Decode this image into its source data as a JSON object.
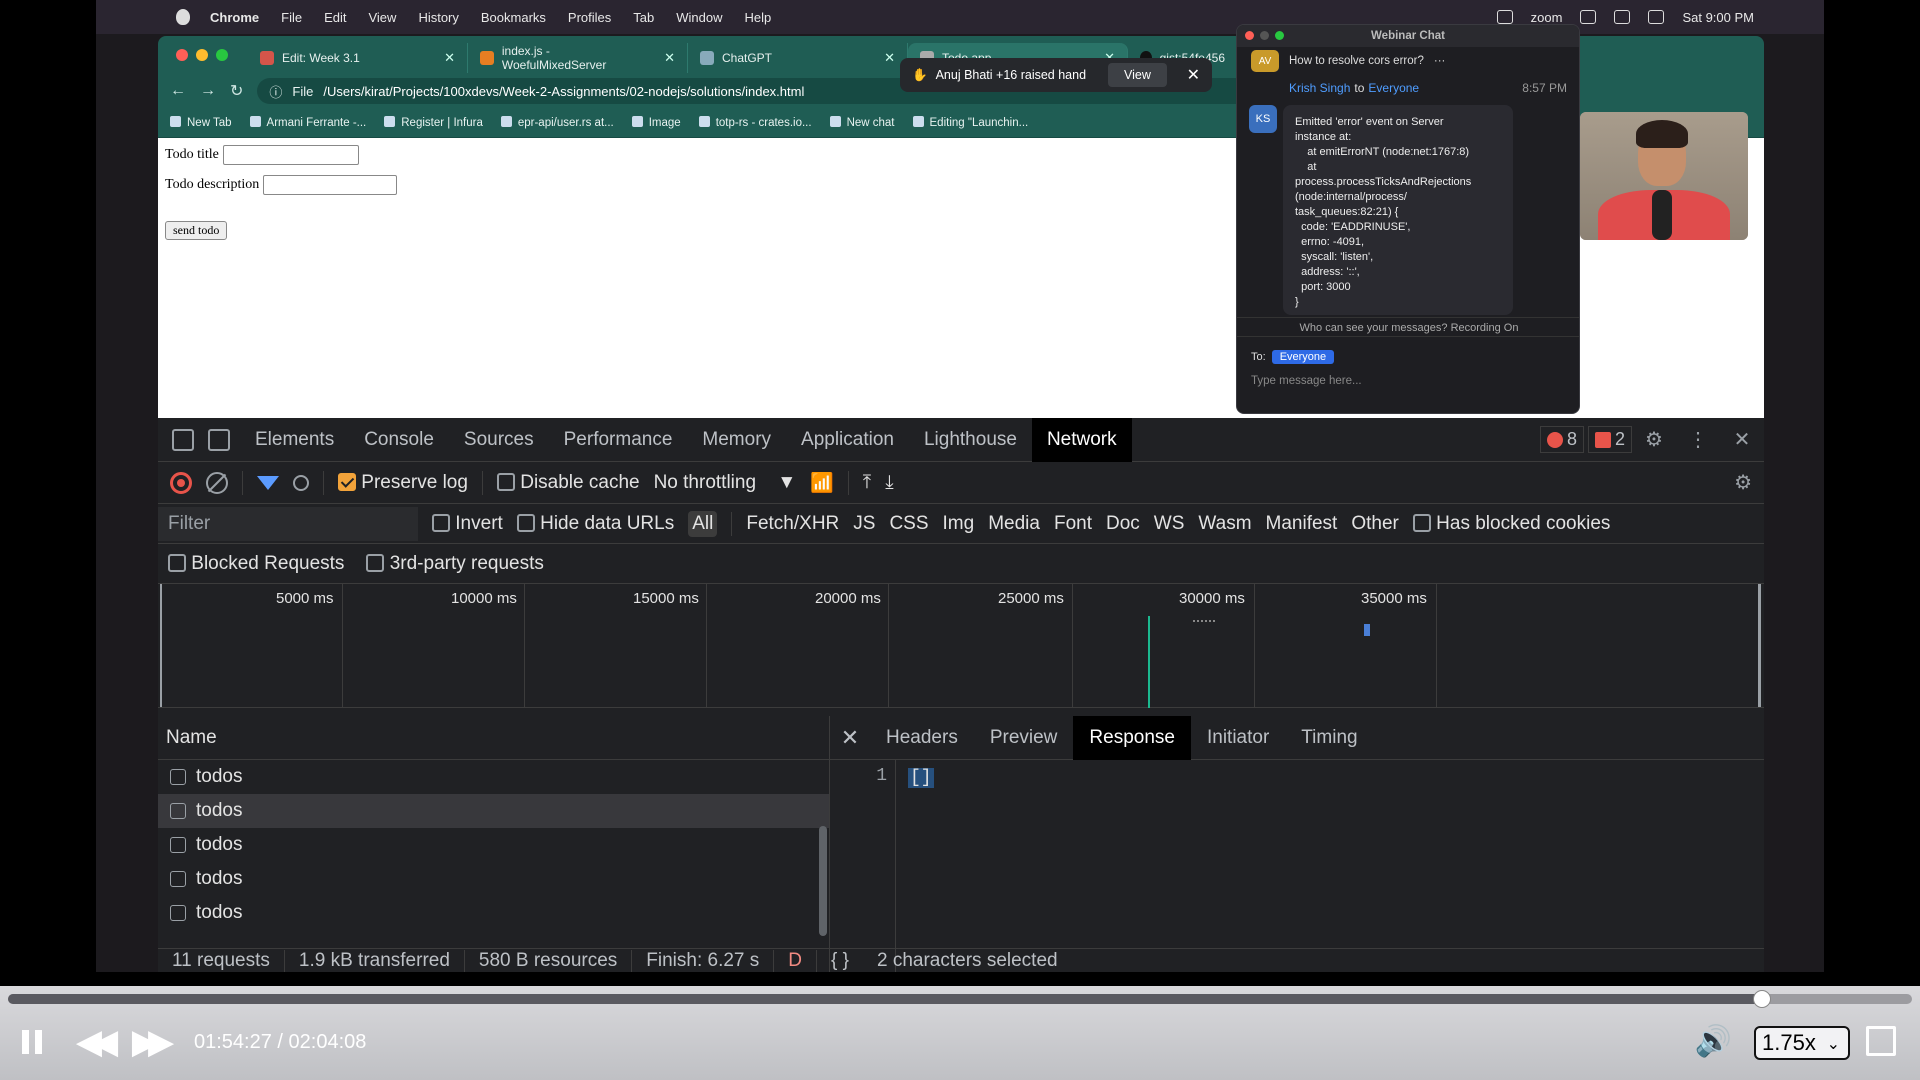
{
  "mac_menu": {
    "app": "Chrome",
    "items": [
      "File",
      "Edit",
      "View",
      "History",
      "Bookmarks",
      "Profiles",
      "Tab",
      "Window",
      "Help"
    ],
    "zoom": "zoom",
    "clock": "Sat 9:00 PM"
  },
  "browser": {
    "tabs": [
      {
        "label": "Edit: Week 3.1"
      },
      {
        "label": "index.js - WoefulMixedServer"
      },
      {
        "label": "ChatGPT"
      },
      {
        "label": "Todo app"
      },
      {
        "label": "gist:54fe456"
      }
    ],
    "address": {
      "prefix": "File",
      "path": "/Users/kirat/Projects/100xdevs/Week-2-Assignments/02-nodejs/solutions/index.html"
    },
    "bookmarks": [
      "New Tab",
      "Armani Ferrante -...",
      "Register | Infura",
      "epr-api/user.rs at...",
      "Image",
      "totp-rs - crates.io...",
      "New chat",
      "Editing \"Launchin..."
    ]
  },
  "page": {
    "title_label": "Todo title",
    "desc_label": "Todo description",
    "send_label": "send todo"
  },
  "raise_hand": {
    "text": "Anuj Bhati +16 raised hand",
    "view": "View"
  },
  "chat": {
    "title": "Webinar Chat",
    "prev_avatar": "AV",
    "prev_message": "How to resolve cors error?",
    "sender": "Krish Singh",
    "to_word": "to",
    "to": "Everyone",
    "time": "8:57 PM",
    "avatar": "KS",
    "message": "Emitted 'error' event on Server\ninstance at:\n    at emitErrorNT (node:net:1767:8)\n    at\nprocess.processTicksAndRejections\n(node:internal/process/\ntask_queues:82:21) {\n  code: 'EADDRINUSE',\n  errno: -4091,\n  syscall: 'listen',\n  address: '::',\n  port: 3000\n}",
    "privacy": "Who can see your messages? Recording On",
    "to_label": "To:",
    "recipient": "Everyone",
    "placeholder": "Type message here..."
  },
  "devtools": {
    "tabs": [
      "Elements",
      "Console",
      "Sources",
      "Performance",
      "Memory",
      "Application",
      "Lighthouse",
      "Network"
    ],
    "active_tab": "Network",
    "errors": "8",
    "warnings": "2",
    "preserve_log": "Preserve log",
    "disable_cache": "Disable cache",
    "throttling": "No throttling",
    "filter_placeholder": "Filter",
    "invert": "Invert",
    "hide_data_urls": "Hide data URLs",
    "types": [
      "All",
      "Fetch/XHR",
      "JS",
      "CSS",
      "Img",
      "Media",
      "Font",
      "Doc",
      "WS",
      "Wasm",
      "Manifest",
      "Other"
    ],
    "has_blocked_cookies": "Has blocked cookies",
    "blocked_requests": "Blocked Requests",
    "third_party": "3rd-party requests",
    "timeline_ticks": [
      "5000 ms",
      "10000 ms",
      "15000 ms",
      "20000 ms",
      "25000 ms",
      "30000 ms",
      "35000 ms"
    ],
    "name_header": "Name",
    "requests": [
      "todos",
      "todos",
      "todos",
      "todos",
      "todos"
    ],
    "detail_tabs": [
      "Headers",
      "Preview",
      "Response",
      "Initiator",
      "Timing"
    ],
    "active_detail": "Response",
    "line_number": "1",
    "response_body": "[]",
    "status": {
      "requests": "11 requests",
      "transferred": "1.9 kB transferred",
      "resources": "580 B resources",
      "finish": "Finish: 6.27 s",
      "trunc": "D",
      "selection": "2 characters selected"
    }
  },
  "player": {
    "current": "01:54:27",
    "total": "02:04:08",
    "separator": "/",
    "rate": "1.75x",
    "progress": 0.921
  }
}
